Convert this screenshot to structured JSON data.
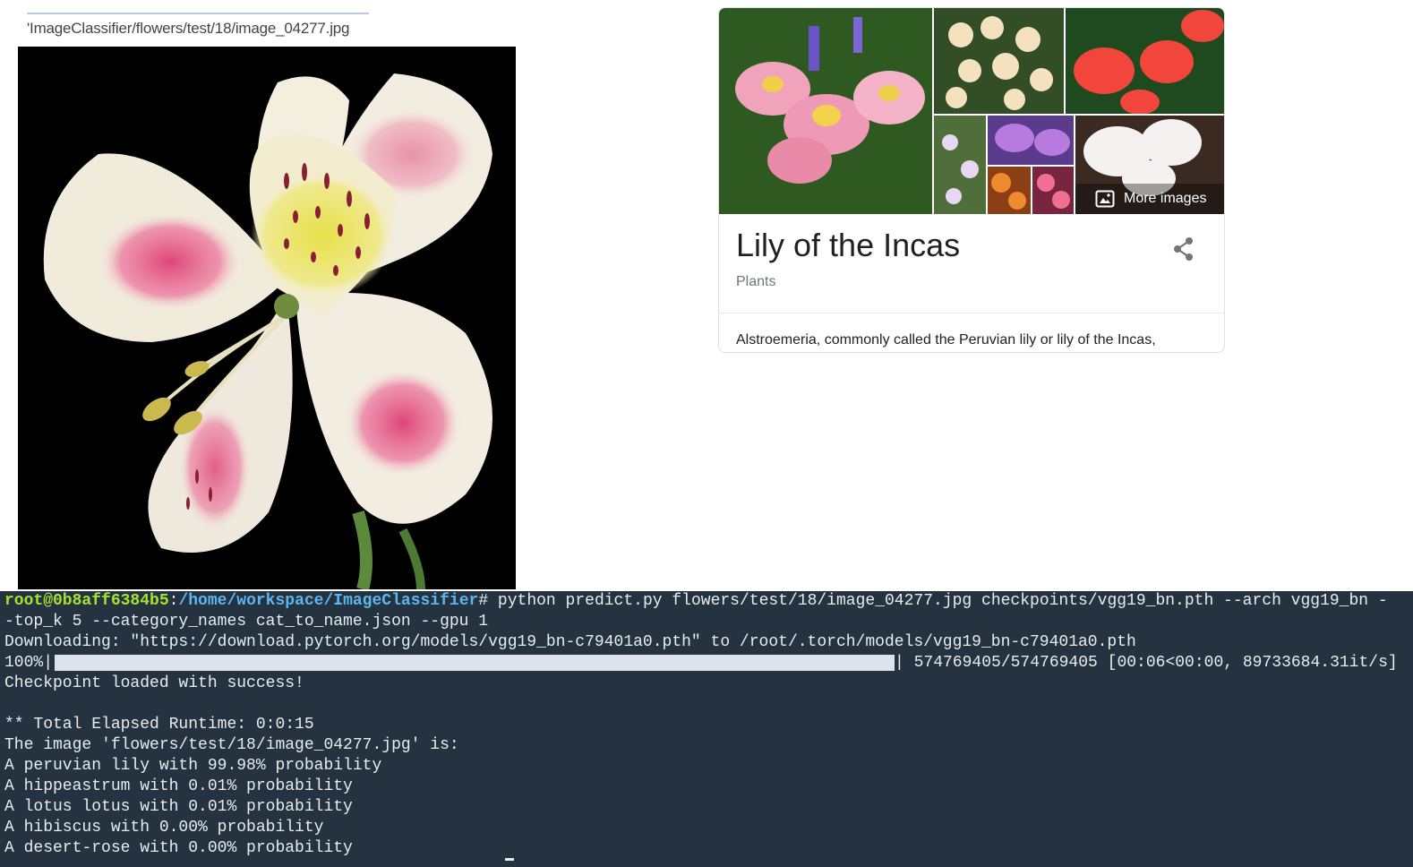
{
  "file_path": "'ImageClassifier/flowers/test/18/image_04277.jpg",
  "knowledge_panel": {
    "more_images_label": "More images",
    "title": "Lily of the Incas",
    "subtitle": "Plants",
    "description": "Alstroemeria, commonly called the Peruvian lily or lily of the Incas,"
  },
  "terminal": {
    "prompt_user": "root@0b8aff6384b5",
    "prompt_sep": ":",
    "prompt_path": "/home/workspace/ImageClassifier",
    "prompt_symbol": "#",
    "command": " python predict.py flowers/test/18/image_04277.jpg checkpoints/vgg19_bn.pth --arch vgg19_bn -",
    "command_cont": "-top_k 5 --category_names cat_to_name.json --gpu 1",
    "download_line": "Downloading: \"https://download.pytorch.org/models/vgg19_bn-c79401a0.pth\" to /root/.torch/models/vgg19_bn-c79401a0.pth",
    "progress_prefix": "100%|",
    "progress_fraction": 1.0,
    "progress_suffix": "| 574769405/574769405 [00:06<00:00, 89733684.31it/s]",
    "checkpoint_line": "Checkpoint loaded with success!",
    "runtime_line": "** Total Elapsed Runtime: 0:0:15",
    "result_header": "The image 'flowers/test/18/image_04277.jpg' is:",
    "predictions": [
      "A peruvian lily with 99.98% probability",
      "A hippeastrum with 0.01% probability",
      "A lotus lotus with 0.01% probability",
      "A hibiscus with 0.00% probability",
      "A desert-rose with 0.00% probability"
    ]
  }
}
